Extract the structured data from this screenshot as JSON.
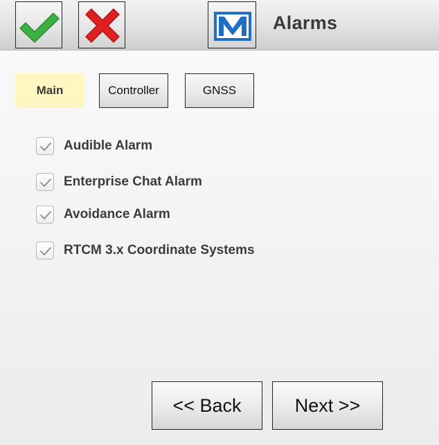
{
  "window": {
    "title": "Alarms"
  },
  "toolbar": {
    "ok_icon": "checkmark-icon",
    "cancel_icon": "close-icon",
    "app_icon": "app-logo-icon",
    "colors": {
      "check": "#3cb043",
      "cross": "#e02020",
      "logo": "#1f6fc4"
    }
  },
  "tabs": [
    {
      "label": "Main",
      "selected": true
    },
    {
      "label": "Controller",
      "selected": false
    },
    {
      "label": "GNSS",
      "selected": false
    }
  ],
  "options": [
    {
      "label": "Audible Alarm",
      "checked": true
    },
    {
      "label": "Enterprise Chat Alarm",
      "checked": true
    },
    {
      "label": "Avoidance Alarm",
      "checked": true
    },
    {
      "label": "RTCM 3.x Coordinate Systems",
      "checked": true
    }
  ],
  "navigation": {
    "back_label": "<< Back",
    "next_label": "Next >>"
  }
}
